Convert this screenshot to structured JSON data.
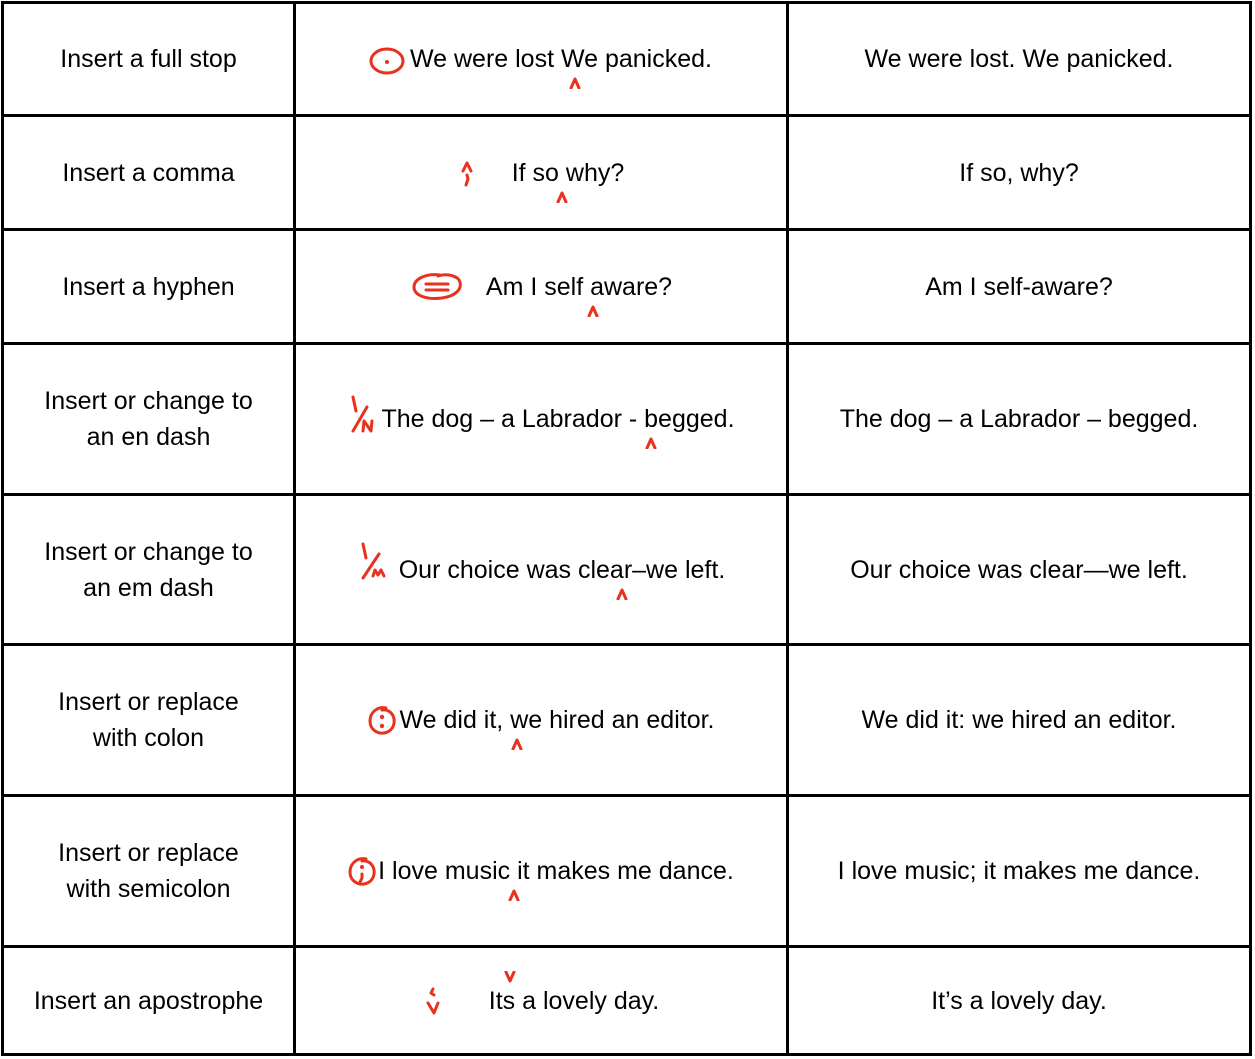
{
  "accent_color": "#e8321e",
  "table": {
    "rows": [
      {
        "instruction": "Insert a full stop",
        "marked": "We were lost We panicked.",
        "mark_icon": "circled-full-stop-icon",
        "corrected": "We were lost. We panicked."
      },
      {
        "instruction": "Insert a comma",
        "marked": "If so why?",
        "mark_icon": "comma-caret-icon",
        "corrected": "If so, why?"
      },
      {
        "instruction": "Insert a hyphen",
        "marked": "Am I self aware?",
        "mark_icon": "circled-hyphen-icon",
        "corrected": "Am I self-aware?"
      },
      {
        "instruction_line1": "Insert or change to",
        "instruction_line2": "an en dash",
        "marked": "The dog – a Labrador - begged.",
        "mark_icon": "en-dash-mark-icon",
        "corrected": "The dog – a Labrador – begged."
      },
      {
        "instruction_line1": "Insert or change to",
        "instruction_line2": "an em dash",
        "marked": "Our choice was clear–we left.",
        "mark_icon": "em-dash-mark-icon",
        "corrected": "Our choice was clear—we left."
      },
      {
        "instruction_line1": "Insert or replace",
        "instruction_line2": "with colon",
        "marked": "We did it, we hired an editor.",
        "mark_icon": "circled-colon-icon",
        "corrected": "We did it: we hired an editor."
      },
      {
        "instruction_line1": "Insert or replace",
        "instruction_line2": "with semicolon",
        "marked": "I love music it makes me dance.",
        "mark_icon": "circled-semicolon-icon",
        "corrected": "I love music; it makes me dance."
      },
      {
        "instruction": "Insert an apostrophe",
        "marked": "Its a lovely day.",
        "mark_icon": "apostrophe-mark-icon",
        "corrected": "It’s a lovely day."
      }
    ]
  }
}
